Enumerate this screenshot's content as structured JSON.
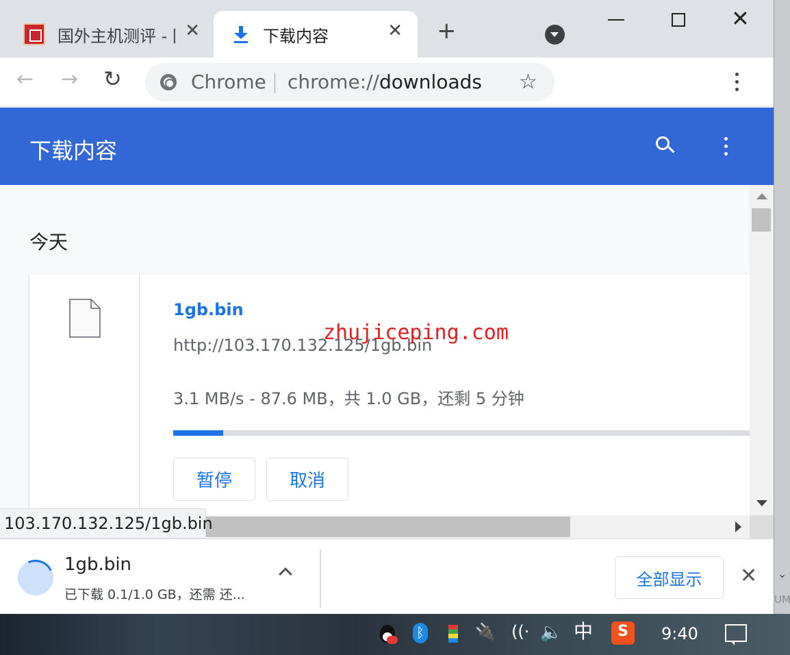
{
  "tabs": [
    {
      "title": "国外主机测评 - 国",
      "close": "✕"
    },
    {
      "title": "下载内容",
      "close": "✕"
    }
  ],
  "tabstrip": {
    "new_tab": "+"
  },
  "toolbar": {
    "back": "←",
    "forward": "→",
    "reload": "↻",
    "omnibox_chip": "Chrome",
    "url_prefix": "chrome://",
    "url_host": "downloads",
    "star": "☆"
  },
  "header": {
    "title": "下载内容"
  },
  "section": {
    "date": "今天"
  },
  "download": {
    "file_name": "1gb.bin",
    "url": "http://103.170.132.125/1gb.bin",
    "status": "3.1 MB/s - 87.6 MB，共 1.0 GB，还剩 5 分钟",
    "progress_fraction": 0.0856,
    "pause_label": "暂停",
    "cancel_label": "取消"
  },
  "watermark": "zhujiceping.com",
  "status_bubble": "103.170.132.125/1gb.bin",
  "shelf": {
    "file_name": "1gb.bin",
    "status": "已下载 0.1/1.0 GB，还需 还...",
    "show_all": "全部显示",
    "close": "✕"
  },
  "right_edge": {
    "chev": "⌄",
    "tag": "UM"
  },
  "taskbar": {
    "bluetooth": "ᛒ",
    "power": "🔌",
    "wifi": "((·",
    "volume": "🔈",
    "ime": "中",
    "sogou": "S",
    "clock": "9:40"
  },
  "colors": {
    "accent": "#3367d6",
    "link": "#1a73e8",
    "watermark": "#e02020"
  }
}
